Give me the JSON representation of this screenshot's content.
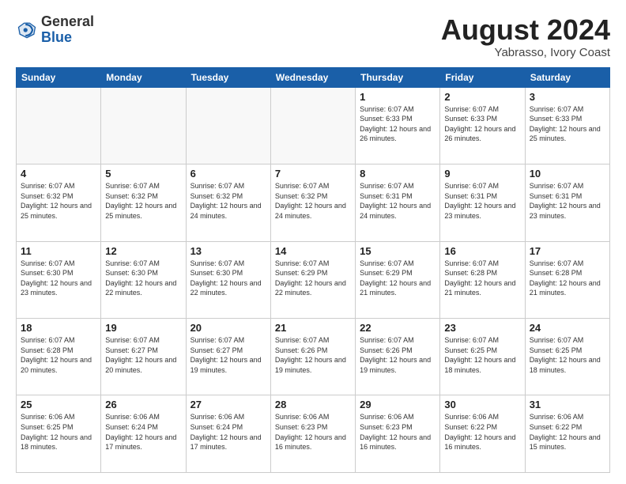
{
  "header": {
    "logo_general": "General",
    "logo_blue": "Blue",
    "title": "August 2024",
    "subtitle": "Yabrasso, Ivory Coast"
  },
  "weekdays": [
    "Sunday",
    "Monday",
    "Tuesday",
    "Wednesday",
    "Thursday",
    "Friday",
    "Saturday"
  ],
  "weeks": [
    [
      {
        "day": "",
        "info": ""
      },
      {
        "day": "",
        "info": ""
      },
      {
        "day": "",
        "info": ""
      },
      {
        "day": "",
        "info": ""
      },
      {
        "day": "1",
        "info": "Sunrise: 6:07 AM\nSunset: 6:33 PM\nDaylight: 12 hours\nand 26 minutes."
      },
      {
        "day": "2",
        "info": "Sunrise: 6:07 AM\nSunset: 6:33 PM\nDaylight: 12 hours\nand 26 minutes."
      },
      {
        "day": "3",
        "info": "Sunrise: 6:07 AM\nSunset: 6:33 PM\nDaylight: 12 hours\nand 25 minutes."
      }
    ],
    [
      {
        "day": "4",
        "info": "Sunrise: 6:07 AM\nSunset: 6:32 PM\nDaylight: 12 hours\nand 25 minutes."
      },
      {
        "day": "5",
        "info": "Sunrise: 6:07 AM\nSunset: 6:32 PM\nDaylight: 12 hours\nand 25 minutes."
      },
      {
        "day": "6",
        "info": "Sunrise: 6:07 AM\nSunset: 6:32 PM\nDaylight: 12 hours\nand 24 minutes."
      },
      {
        "day": "7",
        "info": "Sunrise: 6:07 AM\nSunset: 6:32 PM\nDaylight: 12 hours\nand 24 minutes."
      },
      {
        "day": "8",
        "info": "Sunrise: 6:07 AM\nSunset: 6:31 PM\nDaylight: 12 hours\nand 24 minutes."
      },
      {
        "day": "9",
        "info": "Sunrise: 6:07 AM\nSunset: 6:31 PM\nDaylight: 12 hours\nand 23 minutes."
      },
      {
        "day": "10",
        "info": "Sunrise: 6:07 AM\nSunset: 6:31 PM\nDaylight: 12 hours\nand 23 minutes."
      }
    ],
    [
      {
        "day": "11",
        "info": "Sunrise: 6:07 AM\nSunset: 6:30 PM\nDaylight: 12 hours\nand 23 minutes."
      },
      {
        "day": "12",
        "info": "Sunrise: 6:07 AM\nSunset: 6:30 PM\nDaylight: 12 hours\nand 22 minutes."
      },
      {
        "day": "13",
        "info": "Sunrise: 6:07 AM\nSunset: 6:30 PM\nDaylight: 12 hours\nand 22 minutes."
      },
      {
        "day": "14",
        "info": "Sunrise: 6:07 AM\nSunset: 6:29 PM\nDaylight: 12 hours\nand 22 minutes."
      },
      {
        "day": "15",
        "info": "Sunrise: 6:07 AM\nSunset: 6:29 PM\nDaylight: 12 hours\nand 21 minutes."
      },
      {
        "day": "16",
        "info": "Sunrise: 6:07 AM\nSunset: 6:28 PM\nDaylight: 12 hours\nand 21 minutes."
      },
      {
        "day": "17",
        "info": "Sunrise: 6:07 AM\nSunset: 6:28 PM\nDaylight: 12 hours\nand 21 minutes."
      }
    ],
    [
      {
        "day": "18",
        "info": "Sunrise: 6:07 AM\nSunset: 6:28 PM\nDaylight: 12 hours\nand 20 minutes."
      },
      {
        "day": "19",
        "info": "Sunrise: 6:07 AM\nSunset: 6:27 PM\nDaylight: 12 hours\nand 20 minutes."
      },
      {
        "day": "20",
        "info": "Sunrise: 6:07 AM\nSunset: 6:27 PM\nDaylight: 12 hours\nand 19 minutes."
      },
      {
        "day": "21",
        "info": "Sunrise: 6:07 AM\nSunset: 6:26 PM\nDaylight: 12 hours\nand 19 minutes."
      },
      {
        "day": "22",
        "info": "Sunrise: 6:07 AM\nSunset: 6:26 PM\nDaylight: 12 hours\nand 19 minutes."
      },
      {
        "day": "23",
        "info": "Sunrise: 6:07 AM\nSunset: 6:25 PM\nDaylight: 12 hours\nand 18 minutes."
      },
      {
        "day": "24",
        "info": "Sunrise: 6:07 AM\nSunset: 6:25 PM\nDaylight: 12 hours\nand 18 minutes."
      }
    ],
    [
      {
        "day": "25",
        "info": "Sunrise: 6:06 AM\nSunset: 6:25 PM\nDaylight: 12 hours\nand 18 minutes."
      },
      {
        "day": "26",
        "info": "Sunrise: 6:06 AM\nSunset: 6:24 PM\nDaylight: 12 hours\nand 17 minutes."
      },
      {
        "day": "27",
        "info": "Sunrise: 6:06 AM\nSunset: 6:24 PM\nDaylight: 12 hours\nand 17 minutes."
      },
      {
        "day": "28",
        "info": "Sunrise: 6:06 AM\nSunset: 6:23 PM\nDaylight: 12 hours\nand 16 minutes."
      },
      {
        "day": "29",
        "info": "Sunrise: 6:06 AM\nSunset: 6:23 PM\nDaylight: 12 hours\nand 16 minutes."
      },
      {
        "day": "30",
        "info": "Sunrise: 6:06 AM\nSunset: 6:22 PM\nDaylight: 12 hours\nand 16 minutes."
      },
      {
        "day": "31",
        "info": "Sunrise: 6:06 AM\nSunset: 6:22 PM\nDaylight: 12 hours\nand 15 minutes."
      }
    ]
  ]
}
